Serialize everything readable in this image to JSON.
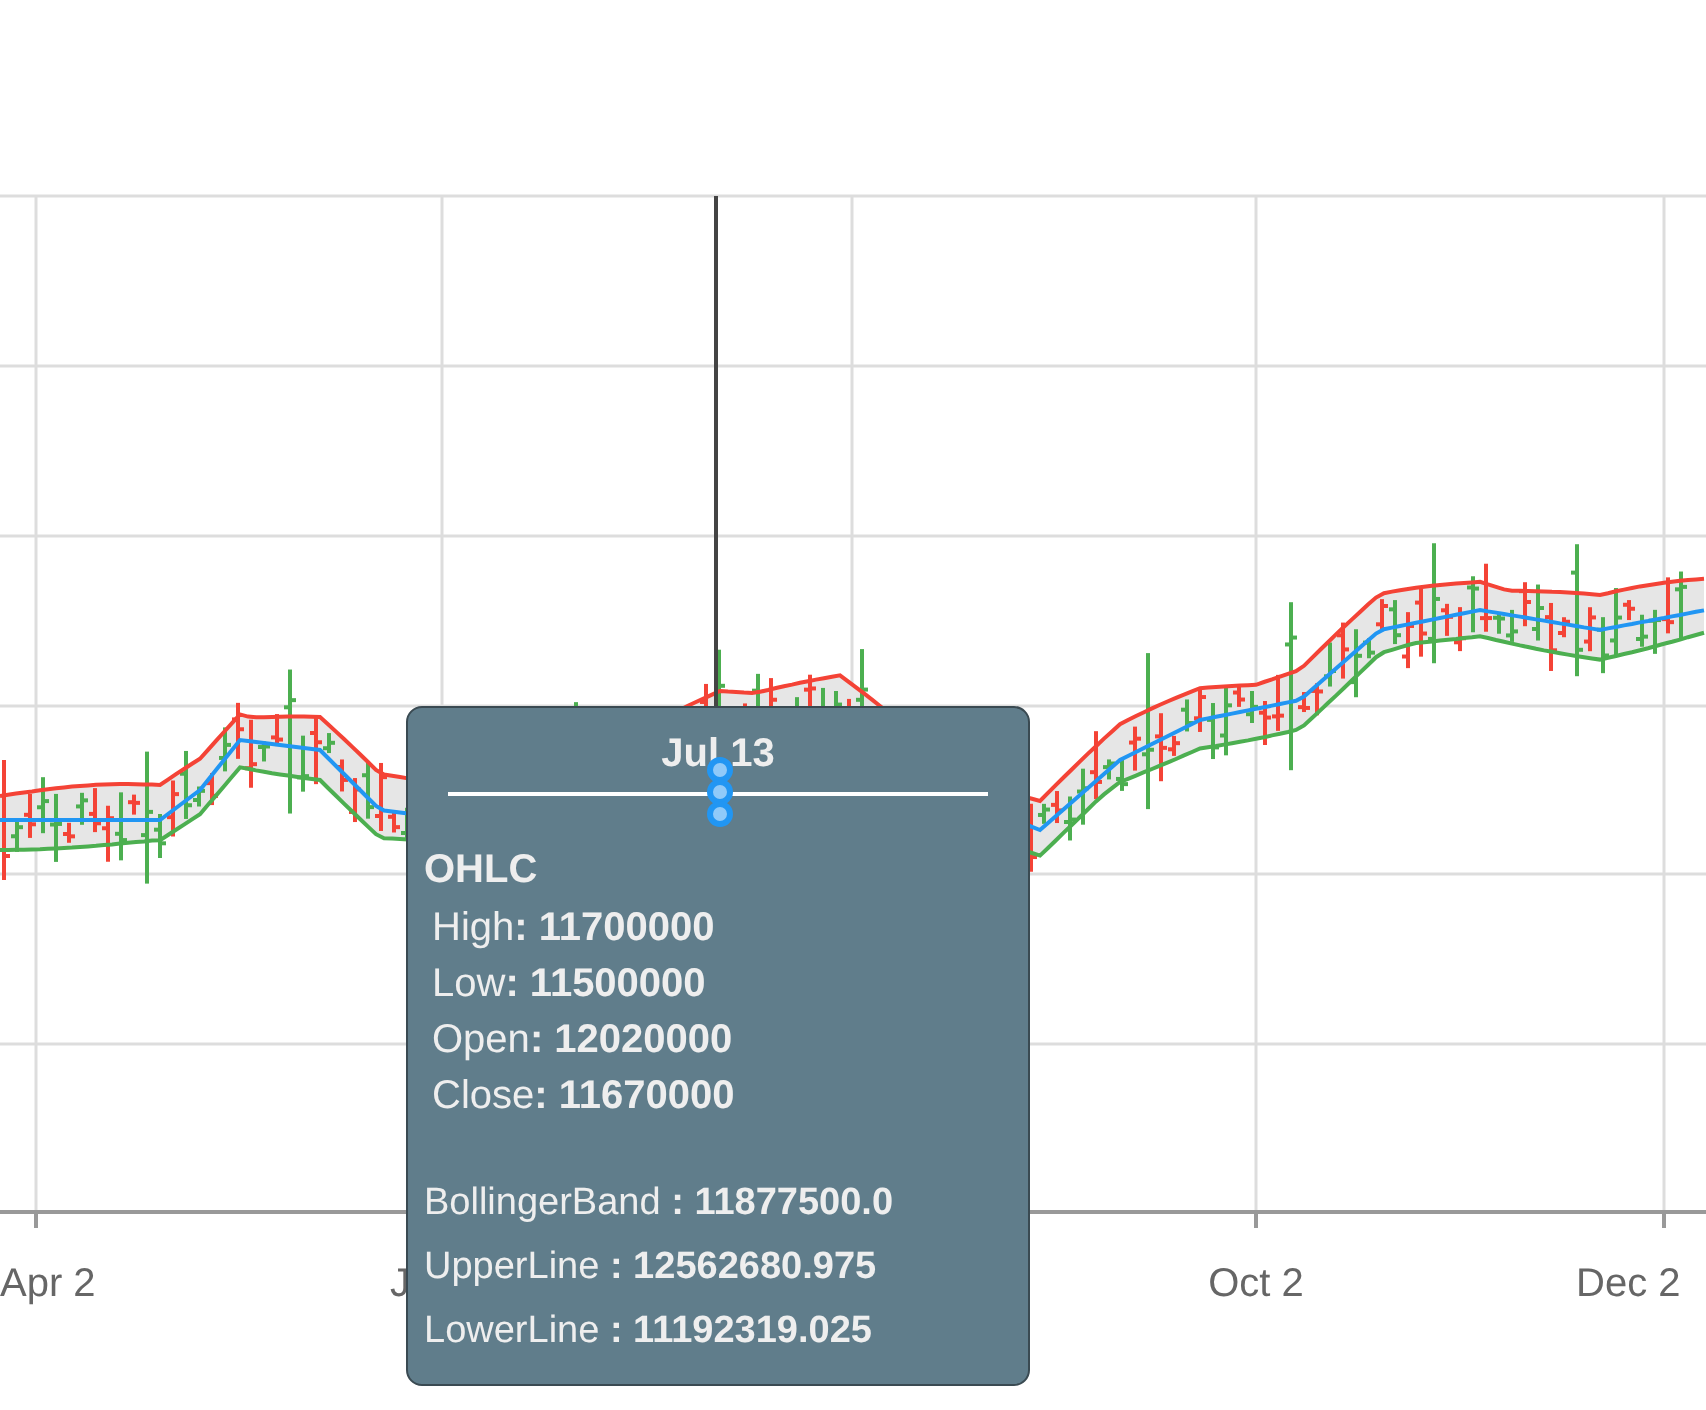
{
  "x_axis": {
    "labels": [
      "Apr 2",
      "J",
      "Oct 2",
      "Dec 2"
    ]
  },
  "tooltip": {
    "title": "Jul 13",
    "group": "OHLC",
    "ohlc": [
      {
        "label": "High",
        "value": ": 11700000"
      },
      {
        "label": "Low",
        "value": ": 11500000"
      },
      {
        "label": "Open",
        "value": ": 12020000"
      },
      {
        "label": "Close",
        "value": ": 11670000"
      }
    ],
    "indicators": [
      {
        "label": "BollingerBand",
        "value": ": 11877500.0"
      },
      {
        "label": "UpperLine",
        "value": ": 12562680.975"
      },
      {
        "label": "LowerLine",
        "value": ": 11192319.025"
      }
    ]
  }
}
